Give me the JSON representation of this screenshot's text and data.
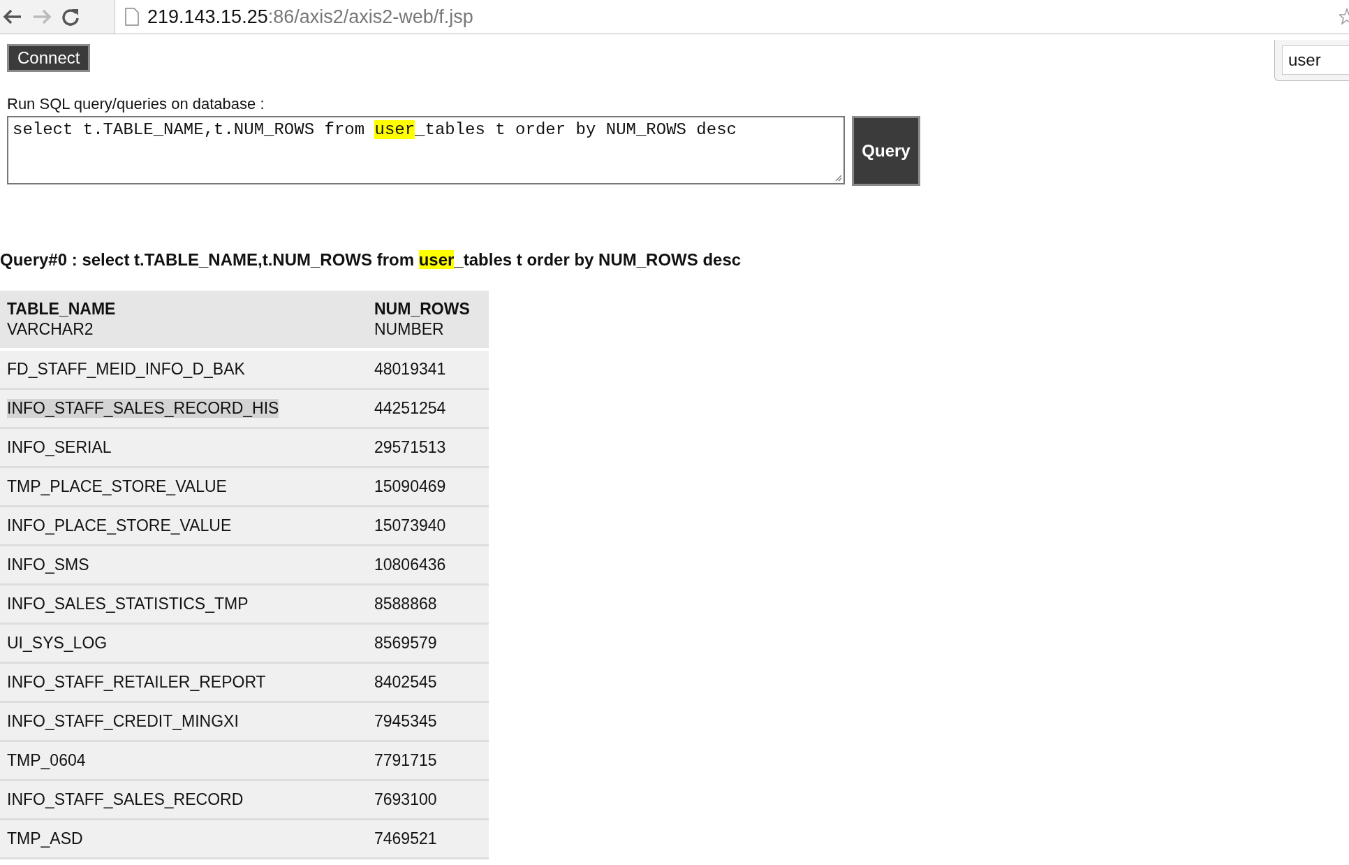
{
  "browser": {
    "url_host": "219.143.15.25",
    "url_path": ":86/axis2/axis2-web/f.jsp"
  },
  "connect_button": "Connect",
  "side_panel": {
    "field_value": "user"
  },
  "query_form": {
    "label": "Run SQL query/queries on database :",
    "query_segments": [
      {
        "text": "select t.TABLE_NAME,t.NUM_ROWS from ",
        "highlighted": false
      },
      {
        "text": "user",
        "highlighted": true
      },
      {
        "text": "_tables t order by NUM_ROWS desc",
        "highlighted": false
      }
    ],
    "button": "Query"
  },
  "result": {
    "title_segments": [
      {
        "text": "Query#0 : select t.TABLE_NAME,t.NUM_ROWS from ",
        "highlighted": false
      },
      {
        "text": "user",
        "highlighted": true
      },
      {
        "text": "_tables t order by NUM_ROWS desc",
        "highlighted": false
      }
    ],
    "columns": [
      {
        "name": "TABLE_NAME",
        "type": "VARCHAR2"
      },
      {
        "name": "NUM_ROWS",
        "type": "NUMBER"
      }
    ],
    "rows": [
      {
        "cells": [
          "FD_STAFF_MEID_INFO_D_BAK",
          "48019341"
        ],
        "selected": false
      },
      {
        "cells": [
          "INFO_STAFF_SALES_RECORD_HIS",
          "44251254"
        ],
        "selected": true
      },
      {
        "cells": [
          "INFO_SERIAL",
          "29571513"
        ],
        "selected": false
      },
      {
        "cells": [
          "TMP_PLACE_STORE_VALUE",
          "15090469"
        ],
        "selected": false
      },
      {
        "cells": [
          "INFO_PLACE_STORE_VALUE",
          "15073940"
        ],
        "selected": false
      },
      {
        "cells": [
          "INFO_SMS",
          "10806436"
        ],
        "selected": false
      },
      {
        "cells": [
          "INFO_SALES_STATISTICS_TMP",
          "8588868"
        ],
        "selected": false
      },
      {
        "cells": [
          "UI_SYS_LOG",
          "8569579"
        ],
        "selected": false
      },
      {
        "cells": [
          "INFO_STAFF_RETAILER_REPORT",
          "8402545"
        ],
        "selected": false
      },
      {
        "cells": [
          "INFO_STAFF_CREDIT_MINGXI",
          "7945345"
        ],
        "selected": false
      },
      {
        "cells": [
          "TMP_0604",
          "7791715"
        ],
        "selected": false
      },
      {
        "cells": [
          "INFO_STAFF_SALES_RECORD",
          "7693100"
        ],
        "selected": false
      },
      {
        "cells": [
          "TMP_ASD",
          "7469521"
        ],
        "selected": false
      }
    ]
  }
}
